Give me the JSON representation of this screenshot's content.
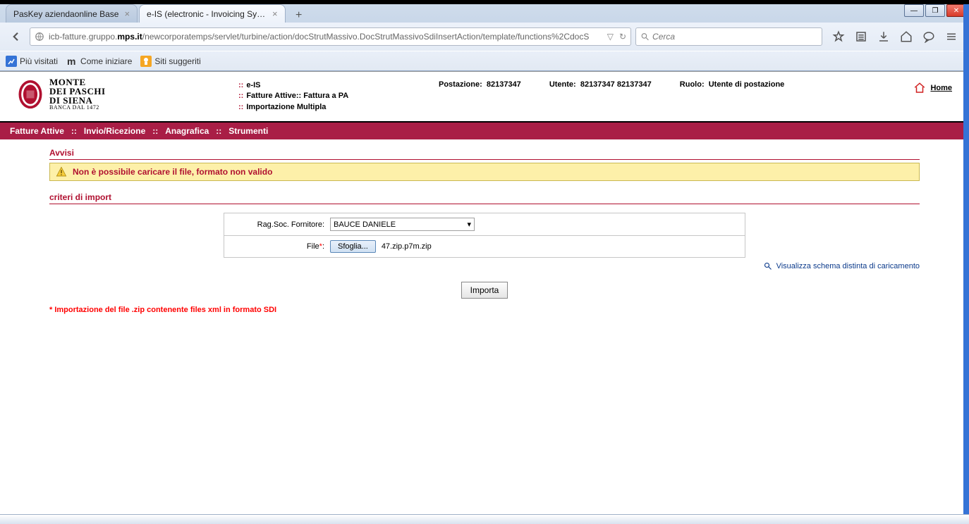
{
  "browser": {
    "tabs": [
      {
        "title": "PasKey aziendaonline Base"
      },
      {
        "title": "e-IS (electronic - Invoicing Syst..."
      }
    ],
    "url_prefix": "icb-fatture.gruppo.",
    "url_bold": "mps.it",
    "url_suffix": "/newcorporatemps/servlet/turbine/action/docStrutMassivo.DocStrutMassivoSdiInsertAction/template/functions%2CdocS",
    "search_placeholder": "Cerca",
    "bookmarks": {
      "most_visited": "Più visitati",
      "getting_started": "Come iniziare",
      "suggested": "Siti suggeriti"
    }
  },
  "header": {
    "logo": {
      "l1": "MONTE",
      "l2": "DEI PASCHI",
      "l3": "DI SIENA",
      "l4": "BANCA DAL 1472"
    },
    "breadcrumbs": [
      "e-IS",
      "Fatture Attive:: Fattura a PA",
      "Importazione Multipla"
    ],
    "postazione_label": "Postazione:",
    "postazione_value": "82137347",
    "utente_label": "Utente:",
    "utente_value": "82137347 82137347",
    "ruolo_label": "Ruolo:",
    "ruolo_value": "Utente di postazione",
    "home": "Home"
  },
  "menu": {
    "items": [
      "Fatture Attive",
      "Invio/Ricezione",
      "Anagrafica",
      "Strumenti"
    ]
  },
  "page": {
    "avvisi_title": "Avvisi",
    "alert_text": "Non è possibile caricare il file, formato non valido",
    "criteri_title": "criteri di import",
    "form": {
      "fornitore_label": "Rag.Soc. Fornitore:",
      "fornitore_value": "BAUCE DANIELE",
      "file_label": "File",
      "browse_button": "Sfoglia...",
      "file_name": "47.zip.p7m.zip"
    },
    "schema_link": "Visualizza schema distinta di caricamento",
    "submit_button": "Importa",
    "note": "* Importazione del file .zip contenente files xml in formato SDI"
  }
}
